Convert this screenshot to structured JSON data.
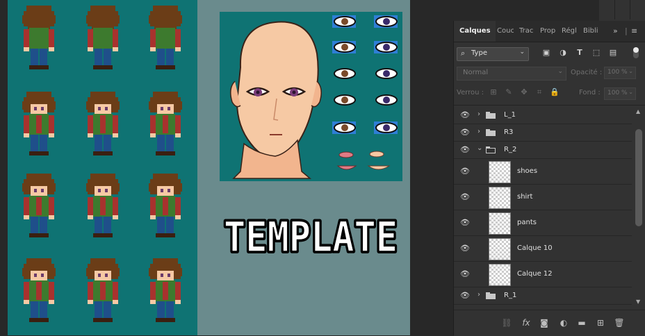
{
  "canvas": {
    "template_label": "TEMPLATE",
    "sprite_bg": "#0f7373",
    "canvas_bg": "#6a8b8d"
  },
  "panel": {
    "tabs": [
      "Calques",
      "Couc",
      "Trac",
      "Prop",
      "Régl",
      "Bibli"
    ],
    "tab_overflow_icon": "double-chevron-right-icon",
    "tab_menu_icon": "hamburger-menu-icon",
    "filter": {
      "type_label": "Type",
      "icons": [
        "image-filter-icon",
        "adjustment-filter-icon",
        "text-filter-icon",
        "shape-filter-icon",
        "smart-object-filter-icon"
      ]
    },
    "blend_mode": "Normal",
    "opacity_label": "Opacité :",
    "opacity_value": "100 %",
    "lock_label": "Verrou :",
    "fill_label": "Fond :",
    "fill_value": "100 %",
    "layers": [
      {
        "name": "L_1",
        "kind": "group",
        "expanded": false
      },
      {
        "name": "R3",
        "kind": "group",
        "expanded": false
      },
      {
        "name": "R_2",
        "kind": "group",
        "expanded": true
      },
      {
        "name": "shoes",
        "kind": "layer"
      },
      {
        "name": "shirt",
        "kind": "layer"
      },
      {
        "name": "pants",
        "kind": "layer"
      },
      {
        "name": "Calque 10",
        "kind": "layer"
      },
      {
        "name": "Calque 12",
        "kind": "layer"
      },
      {
        "name": "R_1",
        "kind": "group",
        "expanded": false
      }
    ],
    "bottom_icons": [
      "link-icon",
      "fx-icon",
      "mask-icon",
      "adjustment-layer-icon",
      "new-group-icon",
      "new-layer-icon",
      "trash-icon"
    ]
  },
  "colors": {
    "panel_bg": "#323232",
    "panel_text": "#e0e0e0",
    "shirt_red": "#a8322e",
    "vest_green": "#3d7a2e",
    "hair_brown": "#6b3d17",
    "pants_blue": "#1f4f8a",
    "skin": "#f6c9a4"
  }
}
